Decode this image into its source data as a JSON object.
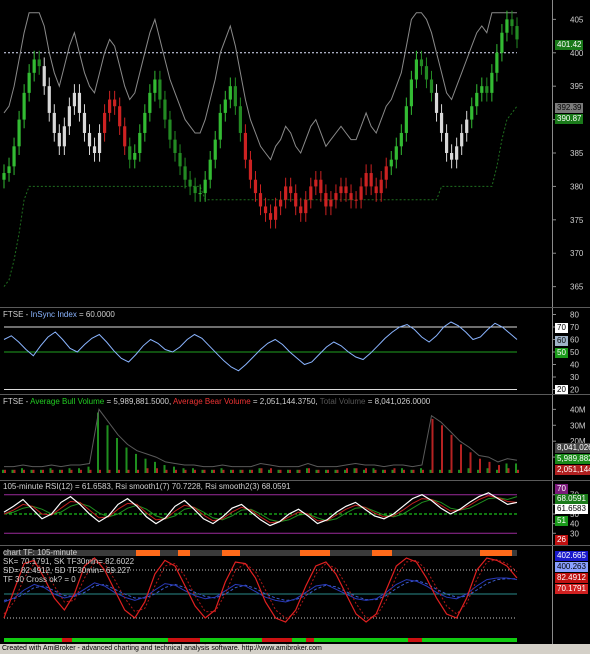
{
  "price_pane": {
    "y_ticks": [
      "405",
      "400",
      "395",
      "390",
      "385",
      "380",
      "375",
      "370",
      "365"
    ],
    "badges": {
      "last_price": "401.42",
      "level_a": "392.39",
      "level_b": "390.87"
    }
  },
  "insync_pane": {
    "title_prefix": "FTSE - ",
    "title_name": "InSync Index",
    "title_value": " = 60.0000",
    "y_ticks": [
      "80",
      "70",
      "60",
      "50",
      "40",
      "30",
      "20"
    ],
    "badges": {
      "upper": "70",
      "value": "60",
      "middle": "50",
      "lower": "20"
    }
  },
  "volume_pane": {
    "title_prefix": "FTSE - ",
    "bull_label": "Average Bull Volume",
    "bull_value": " = 5,989,881.5000, ",
    "bear_label": "Average Bear Volume",
    "bear_value": " = 2,051,144.3750, ",
    "total_label": "Total Volume",
    "total_value": " = 8,041,026.0000",
    "y_ticks": [
      "40M",
      "30M",
      "20M",
      "10M"
    ],
    "badges": {
      "total": "8,041,026",
      "bull": "5,989,882",
      "bear": "2,051,144"
    }
  },
  "rsi_pane": {
    "title": "105-minute RSI(12) = 61.6583, Rsi smooth1(7) 70.7228, Rsi smooth2(3) 68.0591",
    "y_ticks": [
      "70",
      "60",
      "50",
      "40",
      "30"
    ],
    "badges": {
      "top": "70",
      "smooth2": "68.0591",
      "rsi": "61.6583",
      "level": "51",
      "bottom": "26"
    }
  },
  "stoch_pane": {
    "lines": [
      "chart TF: 105-minute",
      "SK= 70.1791,  SK TF30min= 82.6022",
      "SD= 82.4912,  SD TF30min= 69.227",
      "TF 30 Cross ok? = 0"
    ],
    "badges": {
      "b1": "402.665",
      "b2": "400.263",
      "b3": "82.4912",
      "b4": "70.1791"
    }
  },
  "footer": "Created with AmiBroker - advanced charting and technical analysis software. http://www.amibroker.com",
  "colors": {
    "bull": "#22aa22",
    "bear": "#cc2222",
    "neutral": "#cfcfcf",
    "panel_bg": "#000000"
  },
  "chart_data": [
    {
      "type": "candlestick",
      "title": "",
      "ylim": [
        363,
        407
      ],
      "series": [
        {
          "name": "",
          "values": [
            382,
            383,
            386,
            390,
            394,
            397,
            399,
            398,
            395,
            391,
            388,
            386,
            389,
            392,
            394,
            391,
            388,
            386,
            385,
            388,
            391,
            393,
            392,
            389,
            386,
            384,
            385,
            388,
            391,
            394,
            396,
            393,
            390,
            387,
            385,
            383,
            381,
            380,
            379,
            379,
            381,
            384,
            387,
            391,
            393,
            395,
            392,
            388,
            384,
            381,
            379,
            377,
            376,
            375,
            377,
            378,
            380,
            379,
            377,
            376,
            378,
            380,
            381,
            379,
            377,
            378,
            379,
            380,
            379,
            378,
            378,
            380,
            382,
            380,
            379,
            381,
            383,
            384,
            386,
            388,
            392,
            396,
            399,
            398,
            396,
            394,
            391,
            388,
            385,
            384,
            386,
            388,
            390,
            392,
            394,
            395,
            394,
            397,
            400,
            403,
            405,
            404,
            402
          ]
        },
        {
          "name": "Stop",
          "values": [
            365,
            366,
            369,
            373,
            378,
            380,
            380,
            380,
            380,
            380,
            380,
            380,
            380,
            380,
            380,
            380,
            380,
            380,
            380,
            380,
            380,
            380,
            380,
            380,
            380,
            380,
            380,
            380,
            380,
            380,
            380,
            380,
            380,
            380,
            380,
            380,
            380,
            380,
            380,
            380,
            378,
            378,
            378,
            378,
            378,
            378,
            378,
            378,
            378,
            378,
            378,
            378,
            378,
            378,
            378,
            378,
            378,
            378,
            378,
            378,
            378,
            378,
            378,
            378,
            378,
            378,
            378,
            378,
            378,
            378,
            378,
            378,
            378,
            378,
            378,
            378,
            378,
            378,
            378,
            378,
            378,
            378,
            378,
            378,
            378,
            378,
            378,
            380,
            380,
            380,
            380,
            380,
            380,
            380,
            380,
            380,
            380,
            380,
            383,
            387,
            390,
            391,
            392
          ]
        }
      ]
    },
    {
      "type": "line",
      "title": "InSync Index",
      "ylim": [
        18,
        82
      ],
      "series": [
        {
          "name": "InSync Index",
          "values": [
            60,
            63,
            58,
            52,
            47,
            55,
            62,
            66,
            60,
            53,
            50,
            56,
            61,
            64,
            58,
            51,
            45,
            42,
            48,
            55,
            60,
            57,
            52,
            50,
            54,
            60,
            64,
            61,
            55,
            49,
            43,
            38,
            35,
            40,
            46,
            52,
            57,
            60,
            56,
            50,
            45,
            40,
            42,
            48,
            54,
            58,
            55,
            50,
            46,
            44,
            49,
            55,
            61,
            66,
            70,
            72,
            68,
            62,
            58,
            63,
            70,
            74,
            71,
            66,
            60,
            62,
            68,
            73,
            70,
            65,
            60
          ]
        }
      ]
    },
    {
      "type": "bar",
      "title": "Volume",
      "ylim": [
        0,
        44
      ],
      "series": [
        {
          "name": "Average Bull Volume",
          "values": [
            2,
            2,
            3,
            2,
            2,
            3,
            2,
            3,
            3,
            4,
            38,
            30,
            22,
            16,
            12,
            9,
            7,
            5,
            4,
            3,
            3,
            2,
            2,
            3,
            2,
            2,
            2,
            3,
            2,
            2,
            2,
            2,
            3,
            2,
            2,
            2,
            2,
            3,
            2,
            3,
            2,
            2,
            3,
            2,
            3,
            2,
            2,
            2,
            2,
            3,
            2,
            3,
            2,
            6,
            6
          ]
        },
        {
          "name": "Average Bear Volume",
          "values": [
            2,
            2,
            2,
            2,
            2,
            2,
            2,
            2,
            2,
            2,
            2,
            2,
            2,
            2,
            2,
            3,
            3,
            2,
            2,
            2,
            2,
            2,
            2,
            2,
            2,
            2,
            2,
            3,
            3,
            2,
            2,
            2,
            3,
            2,
            2,
            2,
            3,
            3,
            3,
            2,
            2,
            3,
            2,
            2,
            2,
            34,
            30,
            24,
            18,
            13,
            9,
            7,
            5,
            3,
            2
          ]
        }
      ]
    },
    {
      "type": "line",
      "title": "105-minute RSI(12)",
      "ylim": [
        22,
        78
      ],
      "series": [
        {
          "name": "RSI(12)",
          "values": [
            52,
            58,
            65,
            55,
            45,
            50,
            62,
            68,
            60,
            50,
            42,
            48,
            60,
            66,
            58,
            47,
            40,
            46,
            58,
            64,
            55,
            45,
            40,
            47,
            56,
            60,
            52,
            44,
            38,
            42,
            50,
            55,
            48,
            40,
            44,
            52,
            58,
            62,
            55,
            48,
            45,
            50,
            58,
            66,
            70,
            64,
            56,
            50,
            55,
            62,
            68,
            72,
            66,
            60,
            62
          ]
        },
        {
          "name": "Rsi smooth1(7)",
          "values": [
            50,
            54,
            60,
            58,
            50,
            49,
            56,
            63,
            62,
            54,
            46,
            47,
            55,
            61,
            60,
            51,
            44,
            45,
            53,
            59,
            57,
            49,
            43,
            45,
            52,
            57,
            54,
            47,
            41,
            42,
            47,
            52,
            50,
            43,
            43,
            49,
            55,
            59,
            57,
            51,
            47,
            48,
            54,
            61,
            66,
            65,
            59,
            53,
            54,
            59,
            65,
            69,
            67,
            63,
            62
          ]
        },
        {
          "name": "Rsi smooth2(3)",
          "values": [
            50,
            52,
            56,
            58,
            55,
            50,
            52,
            58,
            61,
            58,
            51,
            47,
            50,
            56,
            59,
            55,
            48,
            45,
            48,
            55,
            57,
            52,
            46,
            44,
            48,
            54,
            55,
            50,
            44,
            42,
            44,
            49,
            50,
            46,
            43,
            45,
            51,
            56,
            57,
            53,
            49,
            47,
            50,
            56,
            62,
            65,
            62,
            56,
            54,
            56,
            61,
            66,
            67,
            65,
            68
          ]
        }
      ]
    },
    {
      "type": "line",
      "title": "chart TF: 105-minute",
      "ylim": [
        0,
        100
      ],
      "series": [
        {
          "name": "SK",
          "values": [
            20,
            55,
            88,
            92,
            70,
            45,
            30,
            50,
            85,
            95,
            80,
            55,
            30,
            20,
            40,
            75,
            92,
            85,
            60,
            35,
            20,
            30,
            65,
            90,
            88,
            70,
            40,
            20,
            15,
            30,
            60,
            85,
            90,
            75,
            50,
            25,
            15,
            25,
            55,
            85,
            95,
            90,
            70,
            45,
            25,
            20,
            45,
            80,
            95,
            92,
            85,
            70
          ]
        },
        {
          "name": "SD",
          "values": [
            25,
            40,
            70,
            88,
            82,
            60,
            40,
            42,
            70,
            90,
            88,
            68,
            45,
            28,
            32,
            60,
            85,
            88,
            72,
            48,
            28,
            28,
            50,
            80,
            88,
            78,
            55,
            30,
            20,
            25,
            48,
            75,
            88,
            82,
            62,
            38,
            20,
            22,
            42,
            72,
            90,
            92,
            80,
            58,
            35,
            25,
            38,
            68,
            90,
            93,
            88,
            78
          ]
        },
        {
          "name": "SK TF30min",
          "values": [
            40,
            45,
            55,
            62,
            58,
            50,
            45,
            48,
            56,
            64,
            60,
            52,
            46,
            42,
            46,
            55,
            63,
            61,
            54,
            48,
            44,
            46,
            54,
            62,
            60,
            53,
            46,
            42,
            40,
            44,
            52,
            60,
            62,
            56,
            50,
            44,
            42,
            44,
            52,
            62,
            68,
            66,
            60,
            52,
            46,
            44,
            50,
            60,
            68,
            70,
            70,
            68
          ]
        },
        {
          "name": "SD TF30min",
          "values": [
            42,
            44,
            50,
            58,
            60,
            54,
            48,
            47,
            52,
            60,
            62,
            56,
            50,
            45,
            45,
            50,
            58,
            62,
            58,
            52,
            47,
            45,
            50,
            58,
            61,
            57,
            50,
            45,
            42,
            43,
            48,
            56,
            61,
            59,
            53,
            47,
            43,
            43,
            48,
            57,
            64,
            67,
            63,
            56,
            50,
            46,
            47,
            55,
            63,
            68,
            69,
            69
          ]
        }
      ]
    }
  ]
}
